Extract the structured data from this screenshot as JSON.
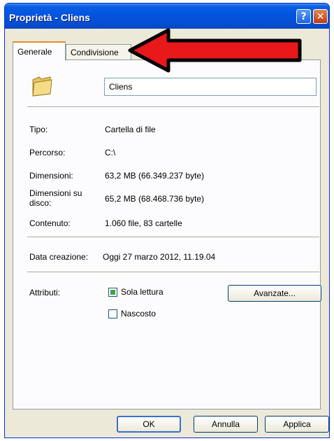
{
  "window": {
    "title": "Proprietà - Cliens",
    "help_glyph": "?",
    "close_glyph": "✕"
  },
  "tabs": [
    {
      "label": "Generale",
      "active": true
    },
    {
      "label": "Condivisione",
      "active": false
    }
  ],
  "general": {
    "name": "Cliens",
    "rows": [
      {
        "label": "Tipo:",
        "value": "Cartella di file"
      },
      {
        "label": "Percorso:",
        "value": "C:\\"
      },
      {
        "label": "Dimensioni:",
        "value": "63,2 MB (66.349.237 byte)"
      },
      {
        "label": "Dimensioni su disco:",
        "value": "65,2 MB (68.468.736 byte)"
      },
      {
        "label": "Contenuto:",
        "value": "1.060 file, 83 cartelle"
      }
    ],
    "created": {
      "label": "Data creazione:",
      "value": "Oggi 27 marzo 2012, 11.19.04"
    },
    "attributes": {
      "label": "Attributi:",
      "readonly": {
        "label": "Sola lettura",
        "state": "mixed"
      },
      "hidden": {
        "label": "Nascosto",
        "state": "unchecked"
      },
      "advanced_button": "Avanzate..."
    }
  },
  "buttons": {
    "ok": "OK",
    "cancel": "Annulla",
    "apply": "Applica"
  },
  "colors": {
    "titlebar": "#0355e0",
    "dialog_bg": "#ece9d8",
    "arrow_fill": "#e8181b",
    "folder": "#f2d67a"
  }
}
